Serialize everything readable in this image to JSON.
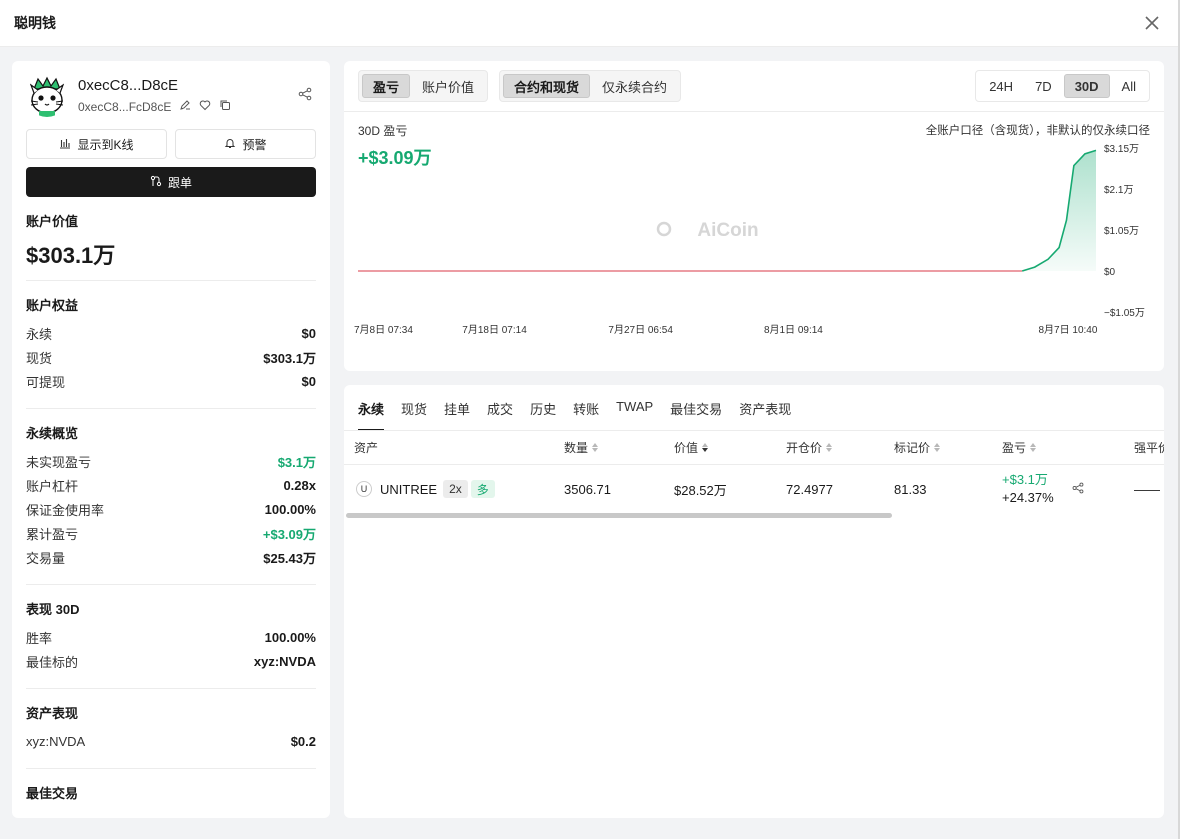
{
  "window": {
    "title": "聪明钱"
  },
  "profile": {
    "name": "0xecC8...D8cE",
    "address": "0xecC8...FcD8cE"
  },
  "actions": {
    "show_kline": "显示到K线",
    "alert": "预警",
    "follow": "跟单"
  },
  "account": {
    "value_label": "账户价值",
    "value": "$303.1万"
  },
  "equity": {
    "title": "账户权益",
    "rows": [
      {
        "k": "永续",
        "v": "$0"
      },
      {
        "k": "现货",
        "v": "$303.1万"
      },
      {
        "k": "可提现",
        "v": "$0"
      }
    ]
  },
  "perp_overview": {
    "title": "永续概览",
    "rows": [
      {
        "k": "未实现盈亏",
        "v": "$3.1万",
        "color": "#16a971"
      },
      {
        "k": "账户杠杆",
        "v": "0.28x"
      },
      {
        "k": "保证金使用率",
        "v": "100.00%"
      },
      {
        "k": "累计盈亏",
        "v": "+$3.09万",
        "color": "#16a971"
      },
      {
        "k": "交易量",
        "v": "$25.43万"
      }
    ]
  },
  "performance": {
    "title": "表现 30D",
    "rows": [
      {
        "k": "胜率",
        "v": "100.00%"
      },
      {
        "k": "最佳标的",
        "v": "xyz:NVDA"
      }
    ]
  },
  "asset_perf": {
    "title": "资产表现",
    "rows": [
      {
        "k": "xyz:NVDA",
        "v": "$0.2"
      }
    ]
  },
  "best_trades": {
    "title": "最佳交易"
  },
  "chart_panel": {
    "metric_tabs": [
      "盈亏",
      "账户价值"
    ],
    "metric_active": 0,
    "scope_tabs": [
      "合约和现货",
      "仅永续合约"
    ],
    "scope_active": 0,
    "range_tabs": [
      "24H",
      "7D",
      "30D",
      "All"
    ],
    "range_active": 2,
    "label": "30D 盈亏",
    "pnl_value": "+$3.09万",
    "note": "全账户口径（含现货），非默认的仅永续口径",
    "watermark": "AiCoin"
  },
  "chart_data": {
    "type": "area",
    "x_ticks": [
      "7月8日 07:34",
      "7月18日 07:14",
      "7月27日 06:54",
      "8月1日 09:14",
      "8月7日 10:40"
    ],
    "y_ticks": [
      "$3.15万",
      "$2.1万",
      "$1.05万",
      "$0",
      "−$1.05万"
    ],
    "ylim": [
      -1.05,
      3.15
    ],
    "y_unit": "万 USD",
    "values_x_frac": [
      0,
      0.1,
      0.2,
      0.3,
      0.4,
      0.5,
      0.6,
      0.7,
      0.8,
      0.9,
      0.917,
      0.935,
      0.95,
      0.96,
      0.97,
      0.985,
      1.0
    ],
    "values": [
      0,
      0,
      0,
      0,
      0,
      0,
      0,
      0,
      0,
      0,
      0.1,
      0.3,
      0.6,
      1.3,
      2.7,
      3.0,
      3.09
    ],
    "colors": {
      "negative": "#e0606c",
      "positive": "#16a971"
    }
  },
  "positions": {
    "tabs": [
      "永续",
      "现货",
      "挂单",
      "成交",
      "历史",
      "转账",
      "TWAP",
      "最佳交易",
      "资产表现"
    ],
    "active_tab": 0,
    "headers": [
      "资产",
      "数量",
      "价值",
      "开仓价",
      "标记价",
      "盈亏",
      "强平价"
    ],
    "rows": [
      {
        "icon": "U",
        "asset": "UNITREE",
        "leverage": "2x",
        "side": "多",
        "qty": "3506.71",
        "value": "$28.52万",
        "entry": "72.4977",
        "mark": "81.33",
        "pnl": "+$3.1万",
        "pnl_pct": "+24.37%",
        "liq": "——"
      }
    ]
  }
}
